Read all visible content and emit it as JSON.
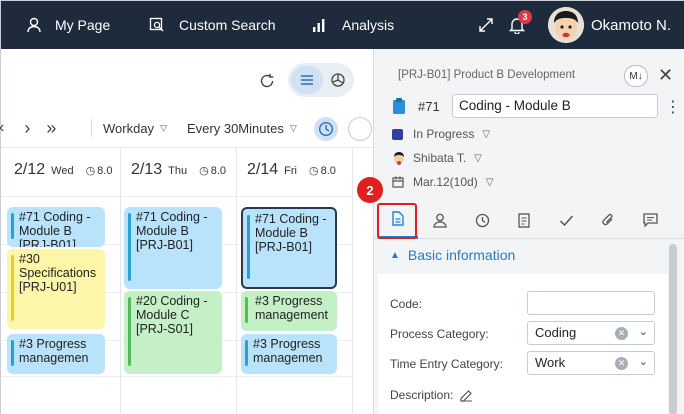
{
  "nav": {
    "my_page": "My Page",
    "custom_search": "Custom Search",
    "analysis": "Analysis",
    "notification_count": "3",
    "user_name": "Okamoto N."
  },
  "calendar": {
    "view_label": "Workday",
    "interval_label": "Every 30Minutes",
    "days": [
      {
        "date": "2/12",
        "weekday": "Wed",
        "time_hint": "8.0"
      },
      {
        "date": "2/13",
        "weekday": "Thu",
        "time_hint": "8.0"
      },
      {
        "date": "2/14",
        "weekday": "Fri",
        "time_hint": "8.0"
      }
    ],
    "cards": [
      {
        "text": "#71 Coding - Module B [PRJ-B01]",
        "color": "blue"
      },
      {
        "text": "#30 Specifications [PRJ-U01]",
        "color": "yellow"
      },
      {
        "text": "#3 Progress managemen",
        "color": "blue"
      },
      {
        "text": "#71 Coding - Module B [PRJ-B01]",
        "color": "blue"
      },
      {
        "text": "#20 Coding - Module C [PRJ-S01]",
        "color": "green"
      },
      {
        "text": "#71 Coding - Module B [PRJ-B01]",
        "color": "blue"
      },
      {
        "text": "#3 Progress management",
        "color": "green"
      },
      {
        "text": "#3 Progress managemen",
        "color": "blue"
      }
    ]
  },
  "panel": {
    "breadcrumb": "[PRJ-B01] Product B Development",
    "md_label": "M↓",
    "task_number": "#71",
    "task_title": "Coding - Module B",
    "status": "In Progress",
    "assignee": "Shibata T.",
    "due": "Mar.12(10d)",
    "step_number": "2",
    "section_title": "Basic information",
    "fields": {
      "code_label": "Code:",
      "code_value": "",
      "process_label": "Process Category:",
      "process_value": "Coding",
      "time_entry_label": "Time Entry Category:",
      "time_entry_value": "Work",
      "description_label": "Description:"
    }
  },
  "colors": {
    "topbar": "#1d2b3d",
    "accent": "#1f86d4",
    "highlight": "#e02020"
  }
}
